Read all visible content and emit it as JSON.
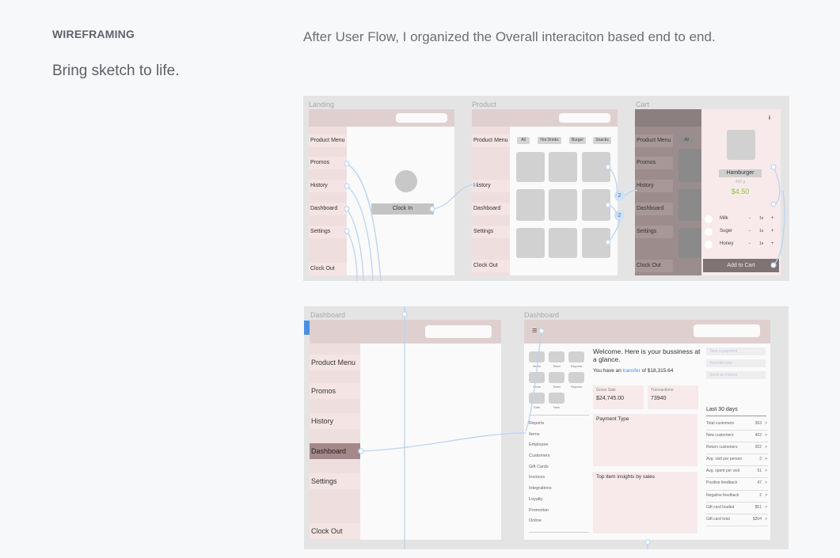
{
  "intro": {
    "eyebrow": "WIREFRAMING",
    "headline": "Bring sketch to life.",
    "description": "After User Flow, I organized the Overall interaciton based end to end."
  },
  "board1": {
    "labels": {
      "landing": "Landing",
      "product": "Product",
      "cart": "Cart"
    },
    "landing": {
      "menu": [
        "Product Menu",
        "Promos",
        "History",
        "Dashboard",
        "Settings",
        "Clock Out"
      ],
      "clock_in": "Clock In"
    },
    "product": {
      "menu": [
        "Product Menu",
        "History",
        "Dashboard",
        "Settings",
        "Clock Out"
      ],
      "chips": [
        "All",
        "Hot Drinks",
        "Burger",
        "Snacks"
      ],
      "badges": [
        "2",
        "2"
      ]
    },
    "cart": {
      "menu": [
        "Product Menu",
        "Promos",
        "History",
        "Dashboard",
        "Settings",
        "Clock Out"
      ],
      "chip": "All",
      "info": "i",
      "item_name": "Hamburger",
      "item_weight": "450 g",
      "item_price": "$4.50",
      "options": [
        {
          "name": "Milk",
          "minus": "-",
          "qty": "1x",
          "plus": "+"
        },
        {
          "name": "Suger",
          "minus": "-",
          "qty": "1x",
          "plus": "+"
        },
        {
          "name": "Honey",
          "minus": "-",
          "qty": "1x",
          "plus": "+"
        }
      ],
      "add_to_cart": "Add to Cart"
    }
  },
  "board2": {
    "labels": {
      "left": "Dashboard",
      "right": "Dashboard"
    },
    "left": {
      "menu": [
        "Product Menu",
        "Promos",
        "History",
        "Dashboard",
        "Settings",
        "Clock Out"
      ]
    },
    "right": {
      "hamburger_glyph": "≡",
      "icon_labels_row1": [
        "Items",
        "Team",
        "Reports"
      ],
      "icon_labels_row2": [
        "Items",
        "Team",
        "Reports"
      ],
      "icon_labels_row3": [
        "Sale",
        "New"
      ],
      "nav": [
        "Reports",
        "Items",
        "Employee",
        "Customers",
        "Gift Cards",
        "Invoices",
        "Integrations",
        "Loyalty",
        "Promotion",
        "Online"
      ],
      "welcome": "Welcome. Here is your bussiness at a glance.",
      "transfer_prefix": "You have an",
      "transfer_link": "transfer",
      "transfer_suffix": "of $18,315.64",
      "gross_label": "Gross Sale",
      "gross_value": "$24,745.00",
      "txn_label": "Transactions",
      "txn_value": "73940",
      "payment_type": "Payment Type",
      "top_item": "Top item insights by sales",
      "actions": [
        "Take a payment",
        "Transfer now",
        "Send an invoice"
      ],
      "last30_title": "Last 30 days",
      "stats": [
        {
          "label": "Total customers",
          "value": "363"
        },
        {
          "label": "New customers",
          "value": "402"
        },
        {
          "label": "Return customers",
          "value": "302"
        },
        {
          "label": "Avg. visit per person",
          "value": "2"
        },
        {
          "label": "Avg. spent per visit",
          "value": "51"
        },
        {
          "label": "Positive feedback",
          "value": "47"
        },
        {
          "label": "Negative feedback",
          "value": "2"
        },
        {
          "label": "Gift card loaded",
          "value": "$51"
        },
        {
          "label": "Gift card total",
          "value": "$204"
        }
      ],
      "chevron": ">"
    }
  },
  "colors": {
    "accent_blue": "#cfe1f6",
    "price_green": "#8bc34a",
    "link_blue": "#4a90e2"
  }
}
